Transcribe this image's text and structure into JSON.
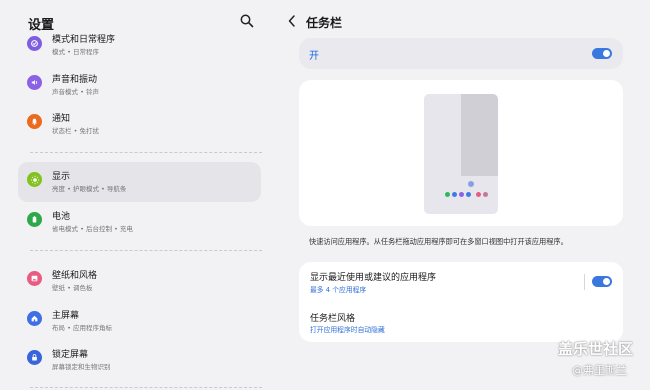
{
  "left": {
    "title": "设置",
    "items": [
      {
        "title": "模式和日常程序",
        "subtitle": "模式 • 日常程序",
        "icon": "modes-icon",
        "color": "#7e5ee0"
      },
      {
        "title": "声音和振动",
        "subtitle": "声音模式 • 铃声",
        "icon": "speaker-icon",
        "color": "#8b62e6"
      },
      {
        "title": "通知",
        "subtitle": "状态栏 • 免打扰",
        "icon": "bell-icon",
        "color": "#ec6a1e"
      },
      {
        "title": "显示",
        "subtitle": "亮度 • 护眼模式 • 导航条",
        "icon": "sun-icon",
        "color": "#82c21f"
      },
      {
        "title": "电池",
        "subtitle": "省电模式 • 后台控制 • 充电",
        "icon": "battery-icon",
        "color": "#2ea84a"
      },
      {
        "title": "壁纸和风格",
        "subtitle": "壁纸 • 调色板",
        "icon": "wallpaper-icon",
        "color": "#e85c82"
      },
      {
        "title": "主屏幕",
        "subtitle": "布局 • 应用程序角标",
        "icon": "home-icon",
        "color": "#3f6fe4"
      },
      {
        "title": "锁定屏幕",
        "subtitle": "屏幕锁定和生物识别",
        "icon": "lock-icon",
        "color": "#3a64dc"
      }
    ]
  },
  "right": {
    "title": "任务栏",
    "master_label": "开",
    "master_on": true,
    "description": "快速访问应用程序。从任务栏拖动应用程序即可在多窗口视图中打开该应用程序。",
    "options": [
      {
        "title": "显示最近使用或建议的应用程序",
        "subtitle": "最多 4 个应用程序",
        "on": true
      },
      {
        "title": "任务栏风格",
        "subtitle": "打开应用程序时自动隐藏"
      }
    ],
    "taskbar_dot_colors": [
      "#2fb85a",
      "#3f7be6",
      "#8b62e6",
      "#3f7be6",
      "#e85c82",
      "#c07aa0"
    ]
  },
  "watermark": {
    "line1": "盖乐世社区",
    "line2": "@弗里斯兰"
  },
  "colors": {
    "accent": "#3a78e0",
    "background": "#f2f2f5",
    "selected": "#e4e4e9"
  }
}
